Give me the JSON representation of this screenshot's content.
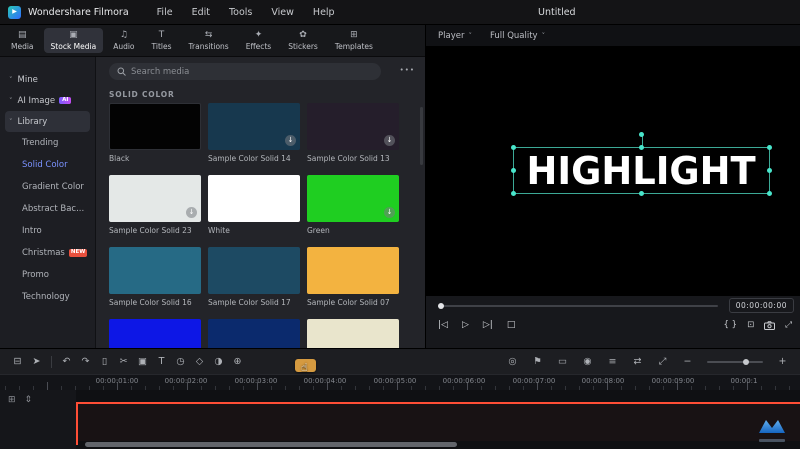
{
  "app": {
    "name": "Wondershare Filmora",
    "project_title": "Untitled",
    "menus": [
      "File",
      "Edit",
      "Tools",
      "View",
      "Help"
    ],
    "logo_glyph": "▶"
  },
  "tabs": [
    {
      "label": "Media",
      "glyph": "▤"
    },
    {
      "label": "Stock Media",
      "glyph": "▣",
      "active": true
    },
    {
      "label": "Audio",
      "glyph": "♫"
    },
    {
      "label": "Titles",
      "glyph": "T"
    },
    {
      "label": "Transitions",
      "glyph": "⇆"
    },
    {
      "label": "Effects",
      "glyph": "✦"
    },
    {
      "label": "Stickers",
      "glyph": "✿"
    },
    {
      "label": "Templates",
      "glyph": "⊞"
    }
  ],
  "player_bar": {
    "player_label": "Player",
    "quality_value": "Full Quality",
    "caret_glyph": "˅"
  },
  "sidebar": {
    "caret_glyph": "˅",
    "groups": [
      {
        "label": "Mine"
      },
      {
        "label": "AI Image",
        "badge": "AI"
      },
      {
        "label": "Library"
      }
    ],
    "items": [
      {
        "label": "Trending"
      },
      {
        "label": "Solid Color",
        "selected": true
      },
      {
        "label": "Gradient Color"
      },
      {
        "label": "Abstract Bac..."
      },
      {
        "label": "Intro"
      },
      {
        "label": "Christmas",
        "badge": "NEW"
      },
      {
        "label": "Promo"
      },
      {
        "label": "Technology"
      }
    ]
  },
  "media_panel": {
    "search_placeholder": "Search media",
    "more_glyph": "•••",
    "section_title": "SOLID COLOR",
    "download_glyph": "↓",
    "swatches": [
      {
        "label": "Black",
        "color": "#030303"
      },
      {
        "label": "Sample Color Solid 14",
        "color": "#17384e"
      },
      {
        "label": "Sample Color Solid 13",
        "color": "#251e2b"
      },
      {
        "label": "Sample Color Solid 23",
        "color": "#e4e8e7"
      },
      {
        "label": "White",
        "color": "#ffffff"
      },
      {
        "label": "Green",
        "color": "#1fce21"
      },
      {
        "label": "Sample Color Solid 16",
        "color": "#266a85"
      },
      {
        "label": "Sample Color Solid 17",
        "color": "#1d4a63"
      },
      {
        "label": "Sample Color Solid 07",
        "color": "#f3b340"
      }
    ],
    "partial_row_colors": [
      "#0d17e6",
      "#0b2a6d",
      "#e9e5cc"
    ]
  },
  "preview": {
    "overlay_text": "HIGHLIGHT",
    "timecode": "00:00:00:00",
    "transport": {
      "prev_glyph": "|◁",
      "play_glyph": "▷",
      "next_glyph": "▷|",
      "stop_glyph": "□"
    },
    "right_icons": {
      "mark_glyph": "{ }",
      "ratio_glyph": "⊡",
      "fullscreen_glyph": "⤢"
    }
  },
  "timeline": {
    "toolbar_left": [
      {
        "name": "media-browser-icon",
        "glyph": "⊟"
      },
      {
        "name": "pointer-icon",
        "glyph": "➤"
      },
      {
        "name": "undo-icon",
        "glyph": "↶"
      },
      {
        "name": "redo-icon",
        "glyph": "↷"
      },
      {
        "name": "delete-icon",
        "glyph": "▯"
      },
      {
        "name": "split-icon",
        "glyph": "✂"
      },
      {
        "name": "crop-icon",
        "glyph": "▣"
      },
      {
        "name": "text-tool-icon",
        "glyph": "T"
      },
      {
        "name": "speed-icon",
        "glyph": "◷"
      },
      {
        "name": "keyframe-icon",
        "glyph": "◇"
      },
      {
        "name": "chroma-key-icon",
        "glyph": "◑"
      },
      {
        "name": "motion-track-icon",
        "glyph": "⊕"
      }
    ],
    "toolbar_right": [
      {
        "name": "render-preview-icon",
        "glyph": "◎"
      },
      {
        "name": "marker-icon",
        "glyph": "⚑"
      },
      {
        "name": "device-preview-icon",
        "glyph": "▭"
      },
      {
        "name": "voiceover-icon",
        "glyph": "◉"
      },
      {
        "name": "mixer-icon",
        "glyph": "≡"
      },
      {
        "name": "auto-ripple-icon",
        "glyph": "⇄"
      },
      {
        "name": "zoom-fit-icon",
        "glyph": "⤢"
      }
    ],
    "zoom_out_glyph": "−",
    "zoom_in_glyph": "+",
    "ruler_labels": [
      "00:00:01:00",
      "00:00:02:00",
      "00:00:03:00",
      "00:00:04:00",
      "00:00:05:00",
      "00:00:06:00",
      "00:00:07:00",
      "00:00:08:00",
      "00:00:09:00",
      "00:00:1"
    ],
    "playhead_cursor_glyph": "☝",
    "track_header_icons": [
      {
        "name": "manage-tracks-icon",
        "glyph": "⊞"
      },
      {
        "name": "track-height-icon",
        "glyph": "⇕"
      }
    ]
  }
}
